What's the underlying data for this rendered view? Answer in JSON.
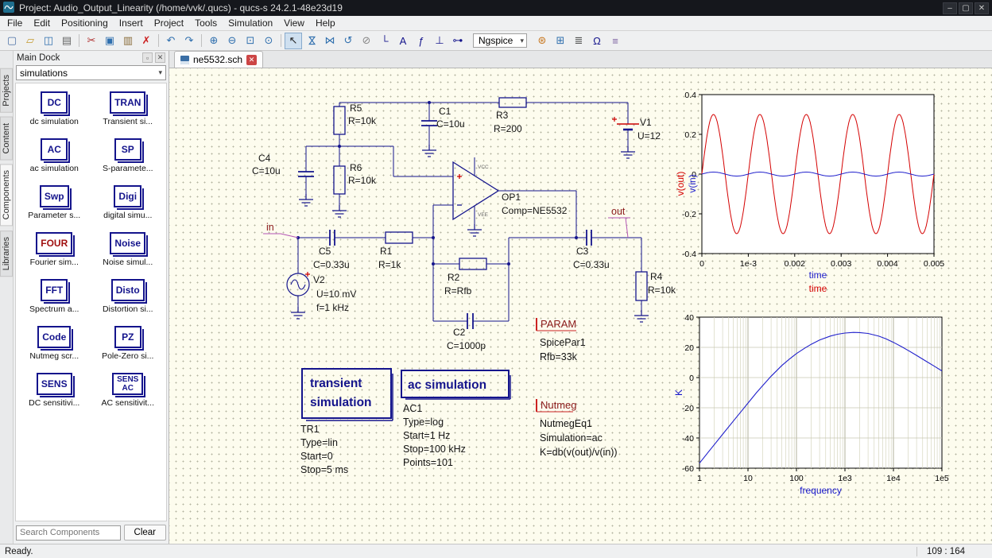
{
  "titlebar": {
    "title": "Project: Audio_Output_Linearity (/home/vvk/.qucs) - qucs-s 24.2.1-48e23d19",
    "window_buttons": [
      {
        "name": "minimize",
        "glyph": "–"
      },
      {
        "name": "maximize",
        "glyph": "▢"
      },
      {
        "name": "close",
        "glyph": "✕"
      }
    ]
  },
  "menubar": {
    "items": [
      "File",
      "Edit",
      "Positioning",
      "Insert",
      "Project",
      "Tools",
      "Simulation",
      "View",
      "Help"
    ]
  },
  "toolbar": {
    "simulator_select": "Ngspice",
    "groups": [
      [
        {
          "name": "new-file",
          "glyph": "▢",
          "color": "#4a6fa5"
        },
        {
          "name": "open-file",
          "glyph": "▱",
          "color": "#c59a2f"
        },
        {
          "name": "save-file",
          "glyph": "◫",
          "color": "#2f6fae"
        },
        {
          "name": "print",
          "glyph": "▤",
          "color": "#666666"
        }
      ],
      [
        {
          "name": "cut",
          "glyph": "✂",
          "color": "#b03030"
        },
        {
          "name": "copy",
          "glyph": "▣",
          "color": "#2f6fae"
        },
        {
          "name": "paste",
          "glyph": "▥",
          "color": "#8a6d3b"
        },
        {
          "name": "delete",
          "glyph": "✗",
          "color": "#cc2222"
        }
      ],
      [
        {
          "name": "undo",
          "glyph": "↶",
          "color": "#2f6fae"
        },
        {
          "name": "redo",
          "glyph": "↷",
          "color": "#2f6fae"
        }
      ],
      [
        {
          "name": "zoom-in",
          "glyph": "⊕",
          "color": "#2f6fae"
        },
        {
          "name": "zoom-out",
          "glyph": "⊖",
          "color": "#2f6fae"
        },
        {
          "name": "zoom-fit",
          "glyph": "⊡",
          "color": "#2f6fae"
        },
        {
          "name": "zoom-1-1",
          "glyph": "⊙",
          "color": "#2f6fae"
        }
      ],
      [
        {
          "name": "select-pointer",
          "glyph": "↖",
          "color": "#222222",
          "active": true
        },
        {
          "name": "mirror-about-x",
          "glyph": "⋈",
          "color": "#2f6fae",
          "rot": true
        },
        {
          "name": "mirror-about-y",
          "glyph": "⋈",
          "color": "#2f6fae"
        },
        {
          "name": "rotate-ccw",
          "glyph": "↺",
          "color": "#2f6fae"
        },
        {
          "name": "deactivate",
          "glyph": "⊘",
          "color": "#888888"
        },
        {
          "name": "insert-wire",
          "glyph": "└",
          "color": "#14148c"
        },
        {
          "name": "insert-node-label",
          "glyph": "A",
          "color": "#14148c"
        },
        {
          "name": "insert-equation",
          "glyph": "ƒ",
          "color": "#14148c"
        },
        {
          "name": "insert-ground",
          "glyph": "⊥",
          "color": "#14148c"
        },
        {
          "name": "insert-port",
          "glyph": "⊶",
          "color": "#14148c"
        }
      ]
    ],
    "after_buttons": [
      {
        "name": "simulate",
        "glyph": "⊛",
        "color": "#c87820"
      },
      {
        "name": "view-data-display",
        "glyph": "⊞",
        "color": "#2f6fae"
      },
      {
        "name": "simulation-settings",
        "glyph": "≣",
        "color": "#555555"
      },
      {
        "name": "calculate-dc-bias",
        "glyph": "Ω",
        "color": "#14148c"
      },
      {
        "name": "tune-mode",
        "glyph": "≡",
        "color": "#7a5fa0"
      }
    ]
  },
  "icons": {
    "chevron_down": "▾",
    "dock_float": "▫",
    "dock_close": "✕",
    "tab_close": "✕"
  },
  "side_tabs": [
    "Projects",
    "Content",
    "Components",
    "Libraries"
  ],
  "dock": {
    "title": "Main Dock",
    "category_select": "simulations",
    "search_placeholder": "Search Components",
    "clear_button": "Clear",
    "items": [
      {
        "id": "dc-simulation",
        "abbr_lines": [
          "DC"
        ],
        "caption": "dc simulation"
      },
      {
        "id": "transient-simulation",
        "abbr_lines": [
          "TRAN"
        ],
        "caption": "Transient si..."
      },
      {
        "id": "ac-simulation",
        "abbr_lines": [
          "AC"
        ],
        "caption": "ac simulation"
      },
      {
        "id": "s-parameter-simulation",
        "abbr_lines": [
          "SP"
        ],
        "caption": "S-paramete..."
      },
      {
        "id": "parameter-sweep",
        "abbr_lines": [
          "Swp"
        ],
        "caption": "Parameter s..."
      },
      {
        "id": "digital-simulation",
        "abbr_lines": [
          "Digi"
        ],
        "caption": "digital simu..."
      },
      {
        "id": "fourier-simulation",
        "abbr_lines": [
          "FOUR"
        ],
        "caption": "Fourier sim...",
        "color": "#a01010"
      },
      {
        "id": "noise-simulation",
        "abbr_lines": [
          "Noise"
        ],
        "caption": "Noise simul..."
      },
      {
        "id": "spectrum-analysis",
        "abbr_lines": [
          "FFT"
        ],
        "caption": "Spectrum a..."
      },
      {
        "id": "distortion-simulation",
        "abbr_lines": [
          "Disto"
        ],
        "caption": "Distortion si..."
      },
      {
        "id": "nutmeg-script",
        "abbr_lines": [
          "Code"
        ],
        "caption": "Nutmeg scr..."
      },
      {
        "id": "pole-zero-simulation",
        "abbr_lines": [
          "PZ"
        ],
        "caption": "Pole-Zero si..."
      },
      {
        "id": "dc-sensitivity",
        "abbr_lines": [
          "SENS"
        ],
        "caption": "DC sensitivi..."
      },
      {
        "id": "ac-sensitivity",
        "abbr_lines": [
          "SENS",
          "AC"
        ],
        "caption": "AC sensitivit..."
      }
    ]
  },
  "document": {
    "tab": "ne5532.sch"
  },
  "schematic": {
    "components": {
      "r5": {
        "name": "R5",
        "value": "R=10k"
      },
      "r6": {
        "name": "R6",
        "value": "R=10k"
      },
      "r3": {
        "name": "R3",
        "value": "R=200"
      },
      "r1": {
        "name": "R1",
        "value": "R=1k"
      },
      "r2": {
        "name": "R2",
        "value": "R=Rfb"
      },
      "r4": {
        "name": "R4",
        "value": "R=10k"
      },
      "c1": {
        "name": "C1",
        "value": "C=10u"
      },
      "c4": {
        "name": "C4",
        "value": "C=10u"
      },
      "c5": {
        "name": "C5",
        "value": "C=0.33u"
      },
      "c2": {
        "name": "C2",
        "value": "C=1000p"
      },
      "c3": {
        "name": "C3",
        "value": "C=0.33u"
      },
      "v1": {
        "name": "V1",
        "value": "U=12"
      },
      "v2": {
        "name": "V2",
        "value": "U=10 mV",
        "value2": "f=1 kHz"
      },
      "op1": {
        "name": "OP1",
        "value": "Comp=NE5532",
        "vcc": "VCC",
        "vee": "VEE"
      }
    },
    "node_labels": {
      "in": "in",
      "out": "out"
    },
    "param_block": {
      "header": "PARAM",
      "line1": "SpicePar1",
      "line2": "Rfb=33k"
    },
    "nutmeg_block": {
      "header": "Nutmeg",
      "line1": "NutmegEq1",
      "line2": "Simulation=ac",
      "line3": "K=db(v(out)/v(in))"
    },
    "transient_block": {
      "title_line1": "transient",
      "title_line2": "simulation",
      "line1": "TR1",
      "line2": "Type=lin",
      "line3": "Start=0",
      "line4": "Stop=5 ms"
    },
    "ac_block": {
      "title": "ac simulation",
      "line1": "AC1",
      "line2": "Type=log",
      "line3": "Start=1 Hz",
      "line4": "Stop=100 kHz",
      "line5": "Points=101"
    }
  },
  "chart_data": [
    {
      "type": "line",
      "position": "top-right",
      "xlabel_stack": [
        {
          "text": "time",
          "color": "#2020cc"
        },
        {
          "text": "time",
          "color": "#d40000"
        }
      ],
      "ylabel_stack": [
        {
          "text": "v(out)",
          "color": "#d40000"
        },
        {
          "text": "v(in)",
          "color": "#2020cc"
        }
      ],
      "xlim": [
        0,
        0.005
      ],
      "ylim": [
        -0.4,
        0.4
      ],
      "x_ticks": [
        "0",
        "1e-3",
        "0.002",
        "0.003",
        "0.004",
        "0.005"
      ],
      "x_tick_values": [
        0,
        0.001,
        0.002,
        0.003,
        0.004,
        0.005
      ],
      "y_ticks": [
        "0.4",
        "0.2",
        "0",
        "-0.2",
        "-0.4"
      ],
      "y_tick_values": [
        0.4,
        0.2,
        0,
        -0.2,
        -0.4
      ],
      "grid": false,
      "series": [
        {
          "name": "v(out)",
          "color": "#d40000",
          "waveform": "sine",
          "amplitude": 0.3,
          "frequency_hz": 1000,
          "cycles_shown": 5
        },
        {
          "name": "v(in)",
          "color": "#2020cc",
          "waveform": "sine",
          "amplitude": 0.01,
          "frequency_hz": 1000,
          "cycles_shown": 5
        }
      ]
    },
    {
      "type": "line",
      "position": "bottom-right",
      "xlabel": "frequency",
      "ylabel": "K",
      "x_scale": "log",
      "xlim": [
        1,
        100000
      ],
      "ylim": [
        -60,
        40
      ],
      "x_ticks": [
        "1",
        "10",
        "100",
        "1e3",
        "1e4",
        "1e5"
      ],
      "x_tick_values": [
        1,
        10,
        100,
        1000,
        10000,
        100000
      ],
      "y_ticks": [
        "40",
        "20",
        "0",
        "-20",
        "-40",
        "-60"
      ],
      "y_tick_values": [
        40,
        20,
        0,
        -20,
        -40,
        -60
      ],
      "grid": true,
      "series": [
        {
          "name": "K",
          "color": "#2020cc",
          "x": [
            1,
            1.5,
            2,
            3,
            5,
            7,
            10,
            15,
            20,
            30,
            50,
            70,
            100,
            150,
            200,
            300,
            500,
            700,
            1000,
            1500,
            2000,
            3000,
            5000,
            7000,
            10000,
            15000,
            20000,
            30000,
            50000,
            70000,
            100000
          ],
          "y": [
            -56.7,
            -49.6,
            -44.6,
            -37.6,
            -28.8,
            -23.0,
            -16.9,
            -10.0,
            -5.4,
            0.9,
            8.0,
            12.0,
            15.9,
            19.6,
            22.0,
            24.9,
            27.5,
            28.7,
            29.5,
            29.9,
            29.8,
            29.2,
            27.4,
            25.7,
            23.3,
            20.3,
            18.0,
            14.7,
            10.3,
            7.5,
            4.4
          ]
        }
      ]
    }
  ],
  "statusbar": {
    "left": "Ready.",
    "right": "109 : 164"
  }
}
